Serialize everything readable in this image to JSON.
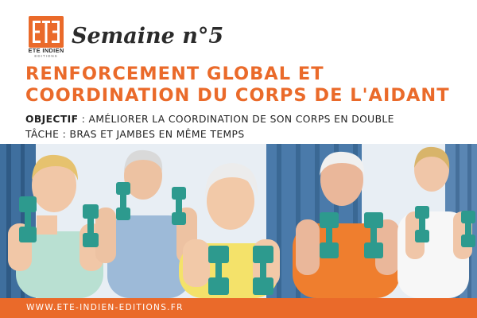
{
  "brand": {
    "name": "ETE INDIEN",
    "subtitle": "EDITIONS",
    "accent_color": "#ea6a2a"
  },
  "week_label": "Semaine n°5",
  "title_lines": [
    "RENFORCEMENT GLOBAL ET",
    "COORDINATION DU CORPS DE L'AIDANT"
  ],
  "objective": {
    "label": "OBJECTIF",
    "line1_rest": " : AMÉLIORER LA COORDINATION DE SON CORPS EN DOUBLE",
    "line2": "TÂCHE : BRAS ET JAMBES EN MÊME TEMPS"
  },
  "photo": {
    "description_icon": "seniors-with-dumbbells-photo"
  },
  "footer": {
    "url": "WWW.ETE-INDIEN-EDITIONS.FR",
    "background_color": "#ea6a2a"
  }
}
